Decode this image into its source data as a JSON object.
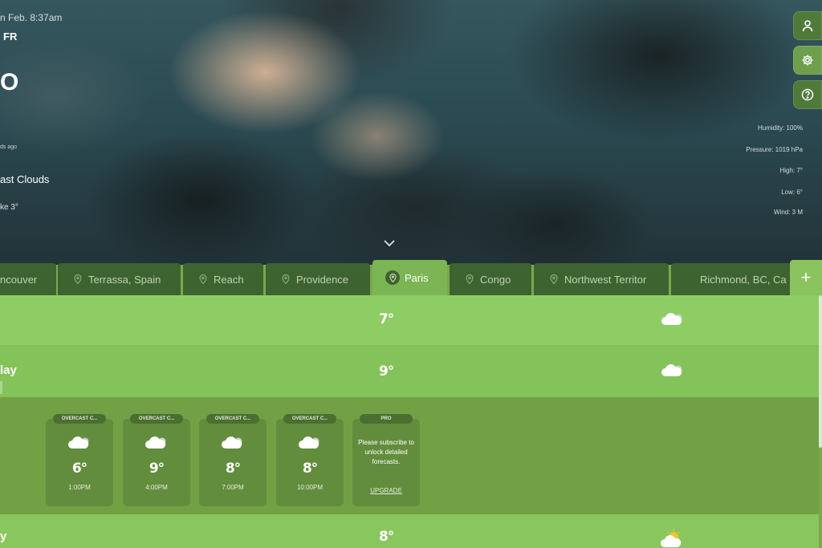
{
  "header": {
    "date": "n Feb. 8:37am",
    "country": "FR",
    "temperature": "O",
    "updated": "ds ago",
    "condition": "ast Clouds",
    "feels_like": "ke 3°"
  },
  "stats": {
    "humidity": "Humidity: 100%",
    "pressure": "Pressure: 1019 hPa",
    "high": "High: 7°",
    "low": "Low: 6°",
    "wind": "Wind: 3 M"
  },
  "side_buttons": [
    "user-icon",
    "gear-icon",
    "help-icon"
  ],
  "tabs": [
    {
      "label": "ncouver",
      "active": false
    },
    {
      "label": "Terrassa, Spain",
      "active": false
    },
    {
      "label": "Reach",
      "active": false
    },
    {
      "label": "Providence",
      "active": false
    },
    {
      "label": "Paris",
      "active": true
    },
    {
      "label": "Congo",
      "active": false
    },
    {
      "label": "Northwest Territor",
      "active": false
    },
    {
      "label": "Richmond, BC, Ca",
      "active": false
    }
  ],
  "add_tab": "+",
  "rows": [
    {
      "day": "",
      "temp": "7°",
      "icon": "cloud-icon"
    },
    {
      "day": "lay",
      "temp": "9°",
      "icon": "cloud-icon"
    },
    {
      "day": "y",
      "temp": "8°",
      "icon": "sun-cloud-icon"
    }
  ],
  "hourly": [
    {
      "badge": "OVERCAST C...",
      "temp": "6°",
      "time": "1:00PM"
    },
    {
      "badge": "OVERCAST C...",
      "temp": "9°",
      "time": "4:00PM"
    },
    {
      "badge": "OVERCAST C...",
      "temp": "8°",
      "time": "7:00PM"
    },
    {
      "badge": "OVERCAST C...",
      "temp": "8°",
      "time": "10:00PM"
    }
  ],
  "pro_card": {
    "badge": "PRO",
    "message": "Please subscribe to unlock detailed forecasts.",
    "link": "UPGRADE"
  },
  "colors": {
    "accent": "#8dcd64",
    "tab": "#3d6330",
    "active_tab": "#7cb553",
    "expanded_row": "#72a145"
  }
}
